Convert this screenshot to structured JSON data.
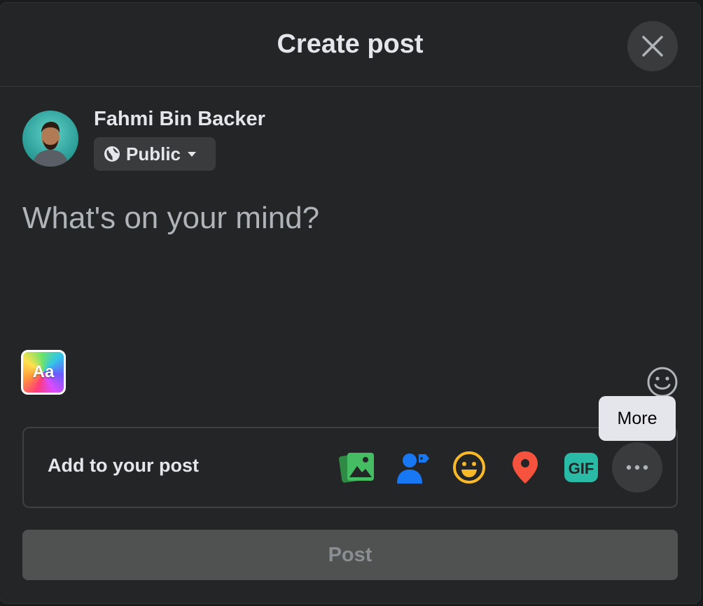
{
  "dialog": {
    "title": "Create post",
    "close_icon": "close-icon"
  },
  "user": {
    "name": "Fahmi Bin Backer",
    "avatar_icon": "avatar"
  },
  "audience": {
    "label": "Public",
    "icon": "globe-icon",
    "dropdown_icon": "caret-down-icon"
  },
  "composer": {
    "value": "",
    "placeholder": "What's on your mind?"
  },
  "background_picker": {
    "label": "Aa"
  },
  "add_to_post": {
    "label": "Add to your post",
    "items": [
      {
        "name": "photo-video",
        "icon": "photo-icon",
        "color": "#45bd62"
      },
      {
        "name": "tag-people",
        "icon": "tag-people-icon",
        "color": "#1877f2"
      },
      {
        "name": "feeling-activity",
        "icon": "smiley-icon",
        "color": "#f7b928"
      },
      {
        "name": "check-in",
        "icon": "location-pin-icon",
        "color": "#f5533d"
      },
      {
        "name": "gif",
        "icon": "gif-icon",
        "label": "GIF",
        "color": "#2abba7"
      },
      {
        "name": "more",
        "icon": "more-dots-icon"
      }
    ]
  },
  "tooltip": {
    "text": "More"
  },
  "post_button": {
    "label": "Post",
    "enabled": false
  },
  "colors": {
    "modal_bg": "#242526",
    "control_bg": "#3a3b3c",
    "text_primary": "#e4e6eb",
    "text_secondary": "#b0b3b8",
    "post_disabled_bg": "#505151"
  }
}
